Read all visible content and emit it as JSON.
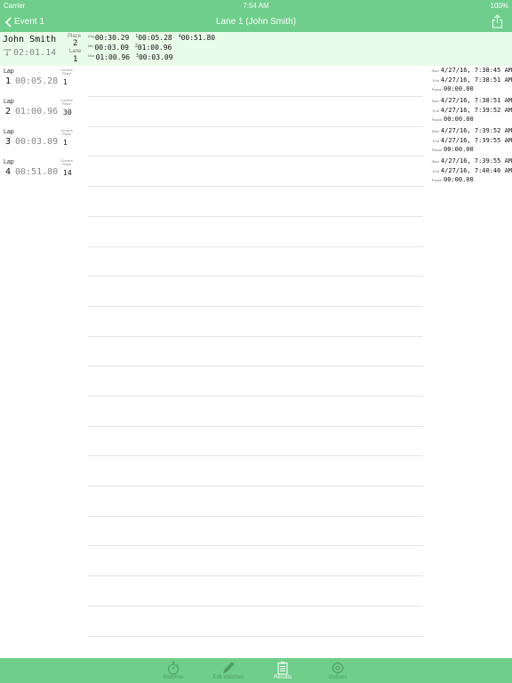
{
  "status_bar": {
    "carrier": "Carrier",
    "time": "7:54 AM",
    "battery": "100%"
  },
  "nav": {
    "back_label": "Event 1",
    "title": "Lane 1 (John Smith)"
  },
  "summary": {
    "name": "John Smith",
    "laps_label": "Laps",
    "laps_value": "4",
    "total_time": "02:01.14",
    "place_label": "Place",
    "place_value": "2",
    "lane_label": "Lane",
    "lane_value": "1",
    "avg": {
      "tag": "Avg",
      "v1": "00:30.29",
      "s2": "1",
      "v2": "00:05.28",
      "s3": "4",
      "v3": "00:51.80"
    },
    "min": {
      "tag": "Min",
      "v1": "00:03.09",
      "s2": "2",
      "v2": "01:00.96"
    },
    "max": {
      "tag": "Max",
      "v1": "01:00.96",
      "s2": "3",
      "v2": "00:03.09"
    }
  },
  "labels": {
    "lap": "Lap",
    "current": "Current",
    "place": "Place",
    "start": "Start",
    "end": "End",
    "pause": "Pause"
  },
  "laps": [
    {
      "num": "1",
      "time": "00:05.28",
      "place": "1",
      "start": "4/27/16, 7:38:45 AM",
      "end": "4/27/16, 7:38:51 AM",
      "pause": "00:00.00"
    },
    {
      "num": "2",
      "time": "01:00.96",
      "place": "30",
      "start": "4/27/16, 7:38:51 AM",
      "end": "4/27/16, 7:39:52 AM",
      "pause": "00:00.00"
    },
    {
      "num": "3",
      "time": "00:03.09",
      "place": "1",
      "start": "4/27/16, 7:39:52 AM",
      "end": "4/27/16, 7:39:55 AM",
      "pause": "00:00.00"
    },
    {
      "num": "4",
      "time": "00:51.80",
      "place": "14",
      "start": "4/27/16, 7:39:55 AM",
      "end": "4/27/16, 7:40:46 AM",
      "pause": "00:00.00"
    }
  ],
  "tabs": [
    {
      "label": "Watches",
      "icon": "stopwatch-icon"
    },
    {
      "label": "Edit Watches",
      "icon": "pencil-icon"
    },
    {
      "label": "Results",
      "icon": "clipboard-icon"
    },
    {
      "label": "Options",
      "icon": "gear-icon"
    }
  ],
  "colors": {
    "accent": "#6fce8b",
    "summary_bg": "#e9fbe9",
    "tab_inactive": "#4e9e66"
  }
}
